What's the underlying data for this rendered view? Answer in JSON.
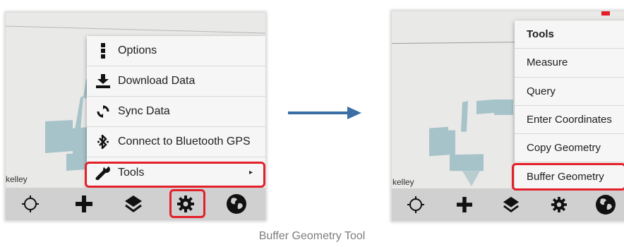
{
  "left": {
    "map_label": "kelley",
    "menu": [
      {
        "icon": "more-vert-icon",
        "label": "Options"
      },
      {
        "icon": "download-icon",
        "label": "Download Data"
      },
      {
        "icon": "sync-icon",
        "label": "Sync Data"
      },
      {
        "icon": "bluetooth-icon",
        "label": "Connect to Bluetooth GPS"
      },
      {
        "icon": "wrench-icon",
        "label": "Tools",
        "submenu_arrow": "▸"
      }
    ]
  },
  "right": {
    "map_label": "kelley",
    "menu": [
      {
        "label": "Tools"
      },
      {
        "label": "Measure"
      },
      {
        "label": "Query"
      },
      {
        "label": "Enter Coordinates"
      },
      {
        "label": "Copy Geometry"
      },
      {
        "label": "Buffer Geometry"
      }
    ]
  },
  "bottom_bar": [
    "gps-crosshair-icon",
    "add-icon",
    "layers-icon",
    "settings-gear-icon",
    "globe-icon"
  ],
  "caption": "Buffer Geometry Tool",
  "colors": {
    "highlight": "#e3202a",
    "arrow": "#3a6ea5",
    "parcel": "#a6c3c9",
    "map_bg": "#e9e9e7",
    "bar_bg": "#d0d0d0"
  }
}
